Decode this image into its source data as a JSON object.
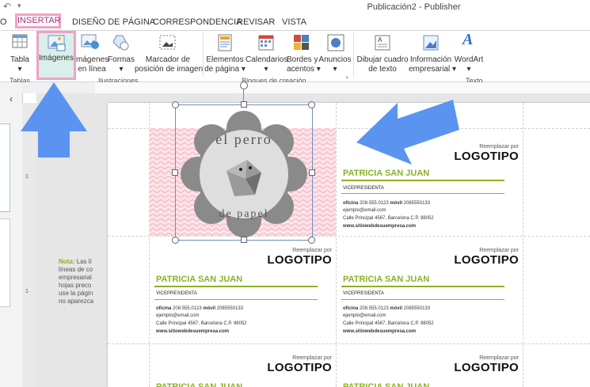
{
  "window": {
    "title": "Publicación2 - Publisher"
  },
  "tabs": [
    {
      "label": "O"
    },
    {
      "label": "INSERTAR"
    },
    {
      "label": "DISEÑO DE PÁGINA"
    },
    {
      "label": "CORRESPONDENCIA"
    },
    {
      "label": "REVISAR"
    },
    {
      "label": "VISTA"
    }
  ],
  "ribbon": {
    "tabla": "Tabla",
    "imagenes": "Imágenes",
    "imagenes_linea_1": "mágenes",
    "imagenes_linea_2": "en línea",
    "formas": "Formas",
    "marcador_1": "Marcador de",
    "marcador_2": "posición de imagen",
    "elementos_1": "Elementos",
    "elementos_2": "de página",
    "calendarios": "Calendarios",
    "bordes_1": "Bordes y",
    "bordes_2": "acentos",
    "anuncios": "Anuncios",
    "dibujar_1": "Dibujar cuadro",
    "dibujar_2": "de texto",
    "info_1": "Información",
    "info_2": "empresarial",
    "wordart": "WordArt",
    "group_tablas": "Tablas",
    "group_ilustraciones": "Ilustraciones",
    "group_bloques": "Bloques de creación",
    "group_texto": "Texto"
  },
  "left_pane": {
    "collapse": "‹"
  },
  "note": {
    "lines": [
      "Las lí",
      "líneas de co",
      "empresarial",
      "hojas preco",
      "use la págin",
      "no aparezca"
    ],
    "label": "Nota:"
  },
  "image_text": {
    "top": "el perro",
    "bottom": "de papel"
  },
  "card": {
    "logo_small": "Reemplazar por",
    "logo_big": "LOGOTIPO",
    "name": "PATRICIA SAN JUAN",
    "role": "VICEPRESIDENTA",
    "phone_label": "oficina",
    "phone": "208.555.0123",
    "mobile_label": "móvil",
    "mobile": "2085550133",
    "email": "ejemplo@email.com",
    "address": "Calle Principal 4567, Barcelona C.P. 98052",
    "web": "www.sitiowebdesuempresa.com"
  },
  "colors": {
    "accent_green": "#8cb125",
    "highlight_pink": "#f0a1c4",
    "arrow_blue": "#4f8ff0"
  }
}
